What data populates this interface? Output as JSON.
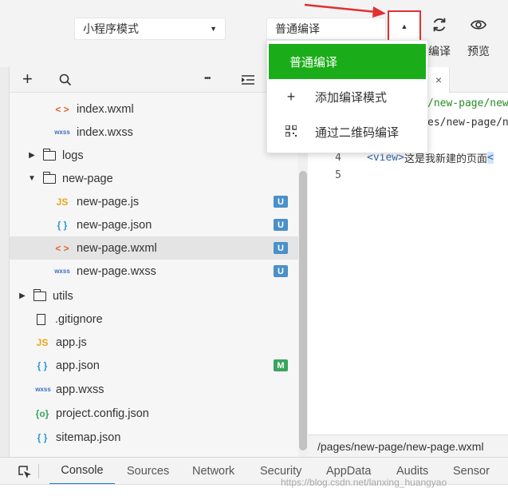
{
  "toolbar": {
    "mode_select": "小程序模式",
    "compile_select": "普通编译",
    "toggle_glyph": "▲",
    "refresh_label": "编译",
    "preview_label": "预览"
  },
  "compile_menu": {
    "items": [
      {
        "label": "普通编译",
        "icon": "none"
      },
      {
        "label": "添加编译模式",
        "icon": "plus-icon"
      },
      {
        "label": "通过二维码编译",
        "icon": "qrcode-icon"
      }
    ]
  },
  "tree_header": {
    "add_glyph": "+",
    "more_glyph": "•••"
  },
  "file_tree": {
    "rows": [
      {
        "name": "index.wxml",
        "icon": "wxml-icon",
        "icon_text": "< >"
      },
      {
        "name": "index.wxss",
        "icon": "wxss-icon",
        "icon_text": "wxss"
      },
      {
        "name": "logs",
        "icon": "folder-icon"
      },
      {
        "name": "new-page",
        "icon": "folder-open-icon"
      },
      {
        "name": "new-page.js",
        "icon": "js-icon",
        "icon_text": "JS",
        "badge": "U"
      },
      {
        "name": "new-page.json",
        "icon": "json-icon",
        "icon_text": "{ }",
        "badge": "U"
      },
      {
        "name": "new-page.wxml",
        "icon": "wxml-icon",
        "icon_text": "< >",
        "badge": "U"
      },
      {
        "name": "new-page.wxss",
        "icon": "wxss-icon",
        "icon_text": "wxss",
        "badge": "U"
      },
      {
        "name": "utils",
        "icon": "folder-icon"
      },
      {
        "name": ".gitignore",
        "icon": "file-icon"
      },
      {
        "name": "app.js",
        "icon": "js-icon",
        "icon_text": "JS"
      },
      {
        "name": "app.json",
        "icon": "json-icon",
        "icon_text": "{ }",
        "badge": "M"
      },
      {
        "name": "app.wxss",
        "icon": "wxss-icon",
        "icon_text": "wxss"
      },
      {
        "name": "project.config.json",
        "icon": "config-json-icon",
        "icon_text": "{o}"
      },
      {
        "name": "sitemap.json",
        "icon": "json-icon",
        "icon_text": "{ }"
      }
    ]
  },
  "editor": {
    "tab_close": "×",
    "lines": [
      {
        "num": "",
        "text": "/new-page/new"
      },
      {
        "num": "",
        "text": "es/new-page/n"
      },
      {
        "num": "4",
        "text_tag_open": "<view>",
        "text_body": "这是我新建的页面",
        "text_tag_close": "<"
      },
      {
        "num": "5",
        "text": ""
      }
    ],
    "status_path": "/pages/new-page/new-page.wxml"
  },
  "console_tabs": [
    "Console",
    "Sources",
    "Network",
    "Security",
    "AppData",
    "Audits",
    "Sensor"
  ],
  "watermark": "https://blog.csdn.net/lanxing_huangyao",
  "colors": {
    "accent_green": "#1aad19",
    "badge_u": "#4a90c9",
    "badge_m": "#3aa55d",
    "annotation_red": "#e03131",
    "active_tab": "#1a73e8"
  }
}
